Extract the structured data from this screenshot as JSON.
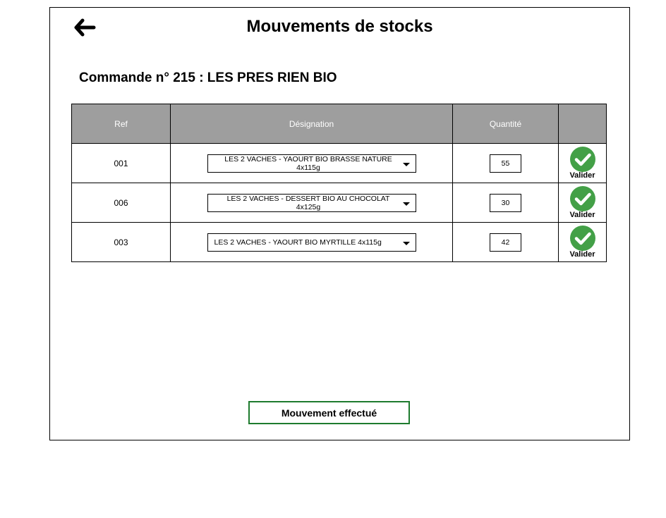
{
  "page": {
    "title": "Mouvements de stocks",
    "order_title": "Commande n° 215 : LES PRES RIEN BIO"
  },
  "colors": {
    "header_bg": "#9e9e9e",
    "validate_green": "#43a047",
    "button_border": "#1e7b2e"
  },
  "table": {
    "headers": {
      "ref": "Ref",
      "designation": "Désignation",
      "quantity": "Quantité",
      "action": ""
    },
    "rows": [
      {
        "ref": "001",
        "designation": "LES 2 VACHES - YAOURT BIO BRASSE NATURE 4x115g",
        "quantity": "55",
        "validate_label": "Valider"
      },
      {
        "ref": "006",
        "designation": "LES 2 VACHES - DESSERT BIO AU CHOCOLAT 4x125g",
        "quantity": "30",
        "validate_label": "Valider"
      },
      {
        "ref": "003",
        "designation": "LES 2 VACHES - YAOURT BIO MYRTILLE 4x115g",
        "quantity": "42",
        "validate_label": "Valider"
      }
    ]
  },
  "actions": {
    "done_label": "Mouvement effectué"
  },
  "icons": {
    "back": "arrow-left-icon",
    "validate": "check-circle-icon",
    "dropdown": "caret-down-icon"
  }
}
